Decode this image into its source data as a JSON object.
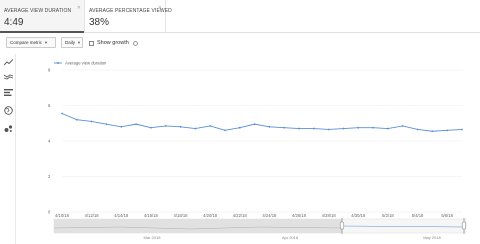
{
  "metrics": [
    {
      "label": "Average view duration",
      "value": "4:49",
      "active": true
    },
    {
      "label": "Average percentage viewed",
      "value": "38%",
      "active": false
    }
  ],
  "toolbar": {
    "compare_label": "Compare metric",
    "daily_label": "Daily",
    "show_growth_label": "Show growth",
    "show_growth_checked": false
  },
  "rail_icons": [
    "line-chart-icon",
    "multiline-chart-icon",
    "bar-chart-icon",
    "map-icon",
    "bubble-chart-icon"
  ],
  "chart_data": {
    "type": "line",
    "legend": "Average view duration",
    "ylim": [
      0,
      8
    ],
    "y_ticks": [
      "0",
      "2",
      "4",
      "6",
      "8"
    ],
    "x": [
      "4/10/18",
      "4/11/18",
      "4/12/18",
      "4/13/18",
      "4/14/18",
      "4/15/18",
      "4/16/18",
      "4/17/18",
      "4/18/18",
      "4/19/18",
      "4/20/18",
      "4/21/18",
      "4/22/18",
      "4/23/18",
      "4/24/18",
      "4/25/18",
      "4/26/18",
      "4/27/18",
      "4/28/18",
      "4/29/18",
      "4/30/18",
      "5/1/18",
      "5/2/18",
      "5/3/18",
      "5/4/18",
      "5/5/18",
      "5/6/18",
      "5/7/18"
    ],
    "x_tick_labels": [
      "4/10/18",
      "4/12/18",
      "4/14/18",
      "4/16/18",
      "4/18/18",
      "4/20/18",
      "4/22/18",
      "4/24/18",
      "4/26/18",
      "4/28/18",
      "4/30/18",
      "5/2/18",
      "5/4/18",
      "5/6/18"
    ],
    "series": [
      {
        "name": "Average view duration",
        "color": "#5b8fd6",
        "values": [
          5.55,
          5.2,
          5.1,
          4.95,
          4.8,
          4.95,
          4.75,
          4.85,
          4.8,
          4.7,
          4.85,
          4.6,
          4.75,
          4.95,
          4.8,
          4.75,
          4.7,
          4.7,
          4.65,
          4.7,
          4.75,
          4.75,
          4.7,
          4.85,
          4.65,
          4.55,
          4.6,
          4.65
        ]
      }
    ],
    "grid": true
  },
  "timeline": {
    "labels": [
      "Mar 2018",
      "Apr 2018",
      "May 2018"
    ]
  }
}
